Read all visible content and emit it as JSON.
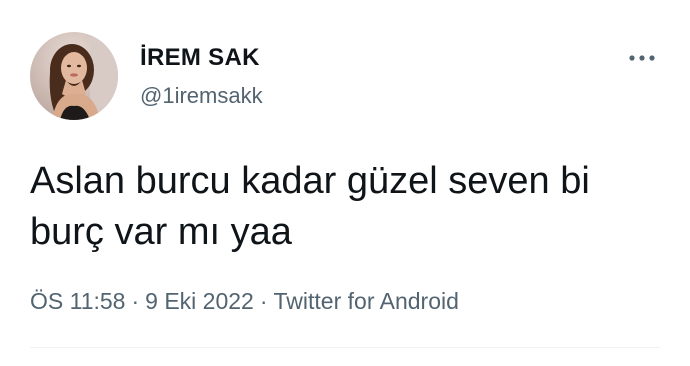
{
  "author": {
    "display_name": "İREM SAK",
    "handle": "@1iremsakk",
    "avatar_icon": "profile-photo"
  },
  "more_icon": "more-horizontal-icon",
  "tweet": {
    "text_lines": [
      "Aslan burcu kadar güzel seven bi",
      "burç var mı yaa"
    ]
  },
  "meta": {
    "time": "ÖS 11:58",
    "separator": "·",
    "date": "9 Eki 2022",
    "source": "Twitter for Android"
  },
  "colors": {
    "text_primary": "#0f1419",
    "text_secondary": "#536471",
    "divider": "#eff3f4"
  }
}
